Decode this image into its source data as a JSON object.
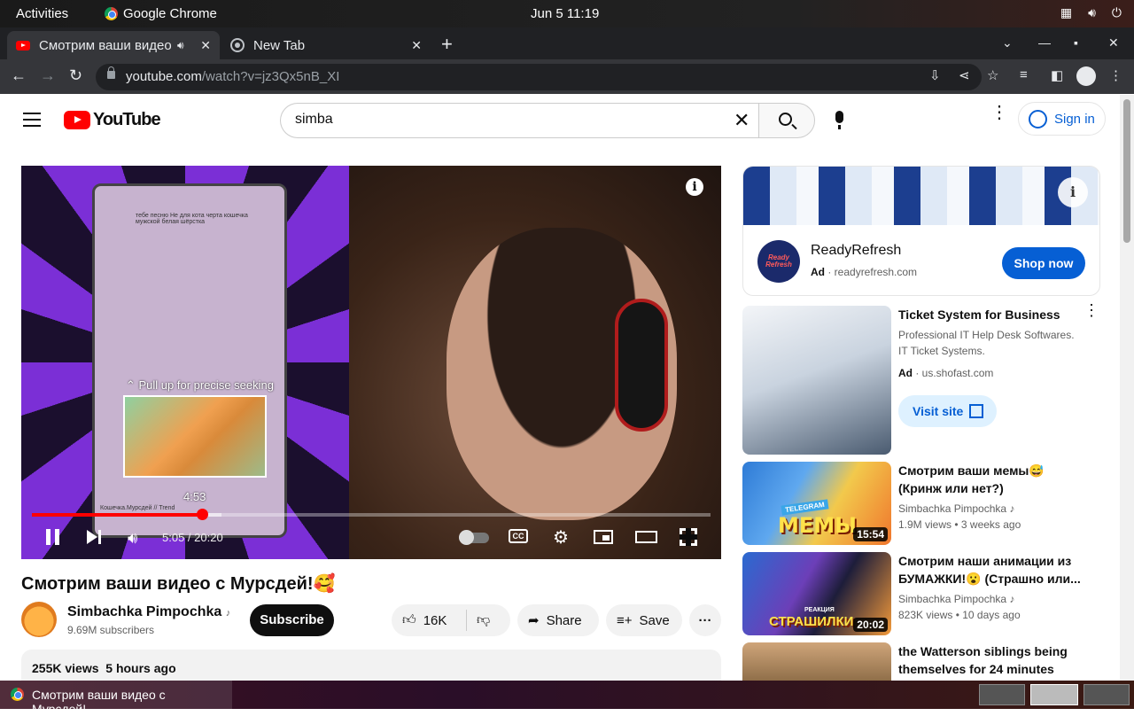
{
  "system": {
    "activities": "Activities",
    "app_name": "Google Chrome",
    "clock": "Jun 5  11:19"
  },
  "browser": {
    "tabs": [
      {
        "label": "Смотрим ваши видео с Мурсдей!",
        "active": true,
        "audio": true
      },
      {
        "label": "New Tab",
        "active": false
      }
    ],
    "url_host": "youtube.com",
    "url_path": "/watch?v=jz3Qx5nB_XI"
  },
  "youtube": {
    "logo_text": "YouTube",
    "search_value": "simba",
    "sign_in": "Sign in"
  },
  "player": {
    "seek_hint": "⌃ Pull up for precise seeking",
    "preview_time": "4:53",
    "current_time": "5:05",
    "duration": "20:20",
    "timecode": "5:05 / 20:20",
    "progress_fraction": 0.25,
    "buffered_fraction": 0.28,
    "overlay_caption": "тебе песню Не для кота черта кошечка мужской белая шёрстка",
    "overlay_footer": "Кошечка.Мурсдей // Trend",
    "cc_label": "CC"
  },
  "video": {
    "title": "Смотрим ваши видео с Мурсдей!🥰",
    "channel": "Simbachka Pimpochka",
    "subscribers": "9.69M subscribers",
    "subscribe_label": "Subscribe",
    "likes": "16K",
    "share_label": "Share",
    "save_label": "Save",
    "views": "255K views",
    "age": "5 hours ago"
  },
  "sidebar": {
    "ad_banner": {
      "advertiser": "ReadyRefresh",
      "ad_label": "Ad",
      "domain": "readyrefresh.com",
      "cta": "Shop now",
      "logo_text": "Ready Refresh"
    },
    "ad_video": {
      "title": "Ticket System for Business",
      "description": "Professional IT Help Desk Softwares. IT Ticket Systems.",
      "ad_label": "Ad",
      "domain": "us.shofast.com",
      "cta": "Visit site"
    },
    "recommendations": [
      {
        "title": "Смотрим ваши мемы😅 (Кринж или нет?)",
        "channel": "Simbachka Pimpochka",
        "views": "1.9M views",
        "age": "3 weeks ago",
        "duration": "15:54",
        "thumb_text": "МЕМЫ",
        "thumb_badge": "TELEGRAM"
      },
      {
        "title": "Смотрим наши анимации из БУМАЖКИ!😮 (Страшно или...",
        "channel": "Simbachka Pimpochka",
        "views": "823K views",
        "age": "10 days ago",
        "duration": "20:02",
        "thumb_text": "СТРАШИЛКИ",
        "thumb_badge": "РЕАКЦИЯ"
      },
      {
        "title": "the Watterson siblings being themselves for 24 minutes"
      }
    ]
  },
  "taskbar": {
    "window_title": "Смотрим ваши видео с Мурсдей!..."
  }
}
